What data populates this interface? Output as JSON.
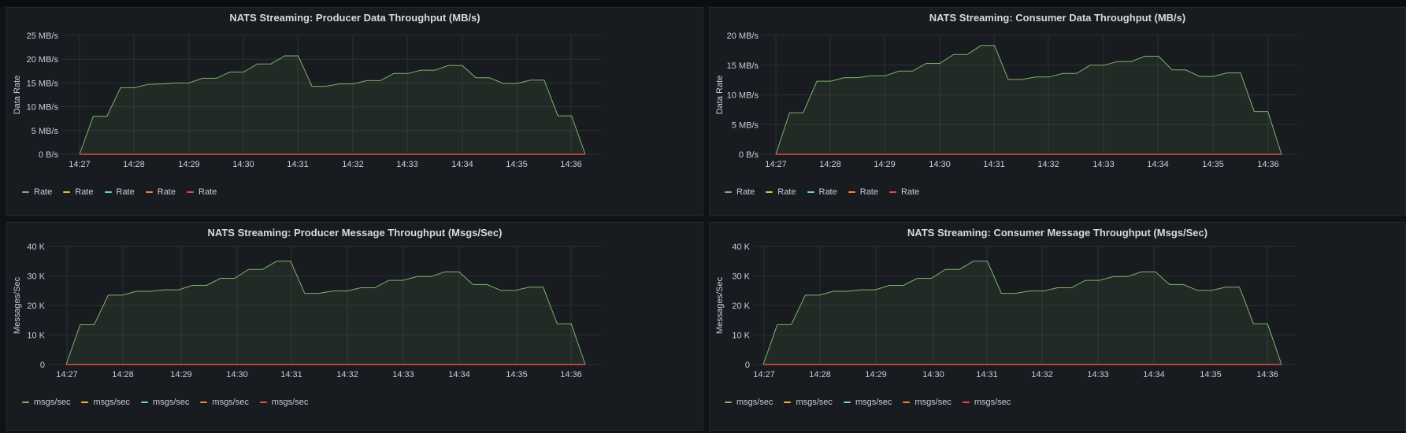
{
  "chart_data": [
    {
      "type": "area",
      "title": "NATS Streaming: Producer Data Throughput (MB/s)",
      "ylabel": "Data Rate",
      "xlabel": "",
      "x_ticks": [
        "14:27",
        "14:28",
        "14:29",
        "14:30",
        "14:31",
        "14:32",
        "14:33",
        "14:34",
        "14:35",
        "14:36"
      ],
      "y_ticks": [
        "0 B/s",
        "5 MB/s",
        "10 MB/s",
        "15 MB/s",
        "20 MB/s",
        "25 MB/s"
      ],
      "ylim": [
        0,
        25
      ],
      "x": [
        "14:27:00",
        "14:27:15",
        "14:27:30",
        "14:27:45",
        "14:28:00",
        "14:28:15",
        "14:28:30",
        "14:28:45",
        "14:29:00",
        "14:29:15",
        "14:29:30",
        "14:29:45",
        "14:30:00",
        "14:30:15",
        "14:30:30",
        "14:30:45",
        "14:31:00",
        "14:31:15",
        "14:31:30",
        "14:31:45",
        "14:32:00",
        "14:32:15",
        "14:32:30",
        "14:32:45",
        "14:33:00",
        "14:33:15",
        "14:33:30",
        "14:33:45",
        "14:34:00",
        "14:34:15",
        "14:34:30",
        "14:34:45",
        "14:35:00",
        "14:35:15",
        "14:35:30",
        "14:35:45",
        "14:36:00",
        "14:36:15"
      ],
      "grid": true,
      "legend_position": "bottom-left",
      "series": [
        {
          "name": "Rate",
          "color": "#7eb26d",
          "values": [
            0,
            8,
            8,
            14,
            14,
            14.7,
            14.8,
            15,
            15,
            16,
            16,
            17.3,
            17.3,
            19,
            19,
            20.7,
            20.7,
            14.3,
            14.3,
            14.8,
            14.8,
            15.5,
            15.5,
            17,
            17,
            17.7,
            17.7,
            18.7,
            18.7,
            16.1,
            16.1,
            14.9,
            14.9,
            15.6,
            15.6,
            8.1,
            8.1,
            0
          ]
        },
        {
          "name": "Rate",
          "color": "#eab839",
          "values": []
        },
        {
          "name": "Rate",
          "color": "#6ed0e0",
          "values": []
        },
        {
          "name": "Rate",
          "color": "#ef843c",
          "values": []
        },
        {
          "name": "Rate",
          "color": "#e24d42",
          "values": [
            0,
            0,
            0,
            0,
            0,
            0,
            0,
            0,
            0,
            0,
            0,
            0,
            0,
            0,
            0,
            0,
            0,
            0,
            0,
            0,
            0,
            0,
            0,
            0,
            0,
            0,
            0,
            0,
            0,
            0,
            0,
            0,
            0,
            0,
            0,
            0,
            0,
            0
          ]
        }
      ]
    },
    {
      "type": "area",
      "title": "NATS Streaming: Consumer Data Throughput (MB/s)",
      "ylabel": "Data Rate",
      "xlabel": "",
      "x_ticks": [
        "14:27",
        "14:28",
        "14:29",
        "14:30",
        "14:31",
        "14:32",
        "14:33",
        "14:34",
        "14:35",
        "14:36"
      ],
      "y_ticks": [
        "0 B/s",
        "5 MB/s",
        "10 MB/s",
        "15 MB/s",
        "20 MB/s"
      ],
      "ylim": [
        0,
        20
      ],
      "x": [
        "14:27:00",
        "14:27:15",
        "14:27:30",
        "14:27:45",
        "14:28:00",
        "14:28:15",
        "14:28:30",
        "14:28:45",
        "14:29:00",
        "14:29:15",
        "14:29:30",
        "14:29:45",
        "14:30:00",
        "14:30:15",
        "14:30:30",
        "14:30:45",
        "14:31:00",
        "14:31:15",
        "14:31:30",
        "14:31:45",
        "14:32:00",
        "14:32:15",
        "14:32:30",
        "14:32:45",
        "14:33:00",
        "14:33:15",
        "14:33:30",
        "14:33:45",
        "14:34:00",
        "14:34:15",
        "14:34:30",
        "14:34:45",
        "14:35:00",
        "14:35:15",
        "14:35:30",
        "14:35:45",
        "14:36:00",
        "14:36:15"
      ],
      "grid": true,
      "legend_position": "bottom-left",
      "series": [
        {
          "name": "Rate",
          "color": "#7eb26d",
          "values": [
            0,
            7,
            7,
            12.3,
            12.3,
            12.9,
            12.9,
            13.2,
            13.2,
            14,
            14,
            15.3,
            15.3,
            16.8,
            16.8,
            18.3,
            18.3,
            12.6,
            12.6,
            13,
            13,
            13.6,
            13.6,
            15,
            15,
            15.6,
            15.6,
            16.5,
            16.5,
            14.2,
            14.2,
            13.1,
            13.1,
            13.7,
            13.7,
            7.2,
            7.2,
            0
          ]
        },
        {
          "name": "Rate",
          "color": "#eab839",
          "values": []
        },
        {
          "name": "Rate",
          "color": "#6ed0e0",
          "values": []
        },
        {
          "name": "Rate",
          "color": "#ef843c",
          "values": []
        },
        {
          "name": "Rate",
          "color": "#e24d42",
          "values": [
            0,
            0,
            0,
            0,
            0,
            0,
            0,
            0,
            0,
            0,
            0,
            0,
            0,
            0,
            0,
            0,
            0,
            0,
            0,
            0,
            0,
            0,
            0,
            0,
            0,
            0,
            0,
            0,
            0,
            0,
            0,
            0,
            0,
            0,
            0,
            0,
            0,
            0
          ]
        }
      ]
    },
    {
      "type": "area",
      "title": "NATS Streaming: Producer Message Throughput (Msgs/Sec)",
      "ylabel": "Messages/Sec",
      "xlabel": "",
      "x_ticks": [
        "14:27",
        "14:28",
        "14:29",
        "14:30",
        "14:31",
        "14:32",
        "14:33",
        "14:34",
        "14:35",
        "14:36"
      ],
      "y_ticks": [
        "0",
        "10 K",
        "20 K",
        "30 K",
        "40 K"
      ],
      "ylim": [
        0,
        40000
      ],
      "x": [
        "14:27:00",
        "14:27:15",
        "14:27:30",
        "14:27:45",
        "14:28:00",
        "14:28:15",
        "14:28:30",
        "14:28:45",
        "14:29:00",
        "14:29:15",
        "14:29:30",
        "14:29:45",
        "14:30:00",
        "14:30:15",
        "14:30:30",
        "14:30:45",
        "14:31:00",
        "14:31:15",
        "14:31:30",
        "14:31:45",
        "14:32:00",
        "14:32:15",
        "14:32:30",
        "14:32:45",
        "14:33:00",
        "14:33:15",
        "14:33:30",
        "14:33:45",
        "14:34:00",
        "14:34:15",
        "14:34:30",
        "14:34:45",
        "14:35:00",
        "14:35:15",
        "14:35:30",
        "14:35:45",
        "14:36:00",
        "14:36:15"
      ],
      "grid": true,
      "legend_position": "bottom-left",
      "series": [
        {
          "name": "msgs/sec",
          "color": "#7eb26d",
          "values": [
            0,
            13500,
            13500,
            23500,
            23500,
            24800,
            24800,
            25300,
            25300,
            26800,
            26800,
            29200,
            29200,
            32200,
            32200,
            35000,
            35000,
            24100,
            24100,
            24900,
            24900,
            26000,
            26000,
            28500,
            28500,
            29800,
            29800,
            31400,
            31400,
            27100,
            27100,
            25100,
            25100,
            26200,
            26200,
            13800,
            13800,
            0
          ]
        },
        {
          "name": "msgs/sec",
          "color": "#eab839",
          "values": []
        },
        {
          "name": "msgs/sec",
          "color": "#6ed0e0",
          "values": []
        },
        {
          "name": "msgs/sec",
          "color": "#ef843c",
          "values": []
        },
        {
          "name": "msgs/sec",
          "color": "#e24d42",
          "values": [
            0,
            0,
            0,
            0,
            0,
            0,
            0,
            0,
            0,
            0,
            0,
            0,
            0,
            0,
            0,
            0,
            0,
            0,
            0,
            0,
            0,
            0,
            0,
            0,
            0,
            0,
            0,
            0,
            0,
            0,
            0,
            0,
            0,
            0,
            0,
            0,
            0,
            0
          ]
        }
      ]
    },
    {
      "type": "area",
      "title": "NATS Streaming: Consumer Message Throughput (Msgs/Sec)",
      "ylabel": "Messages/Sec",
      "xlabel": "",
      "x_ticks": [
        "14:27",
        "14:28",
        "14:29",
        "14:30",
        "14:31",
        "14:32",
        "14:33",
        "14:34",
        "14:35",
        "14:36"
      ],
      "y_ticks": [
        "0",
        "10 K",
        "20 K",
        "30 K",
        "40 K"
      ],
      "ylim": [
        0,
        40000
      ],
      "x": [
        "14:27:00",
        "14:27:15",
        "14:27:30",
        "14:27:45",
        "14:28:00",
        "14:28:15",
        "14:28:30",
        "14:28:45",
        "14:29:00",
        "14:29:15",
        "14:29:30",
        "14:29:45",
        "14:30:00",
        "14:30:15",
        "14:30:30",
        "14:30:45",
        "14:31:00",
        "14:31:15",
        "14:31:30",
        "14:31:45",
        "14:32:00",
        "14:32:15",
        "14:32:30",
        "14:32:45",
        "14:33:00",
        "14:33:15",
        "14:33:30",
        "14:33:45",
        "14:34:00",
        "14:34:15",
        "14:34:30",
        "14:34:45",
        "14:35:00",
        "14:35:15",
        "14:35:30",
        "14:35:45",
        "14:36:00",
        "14:36:15"
      ],
      "grid": true,
      "legend_position": "bottom-left",
      "series": [
        {
          "name": "msgs/sec",
          "color": "#7eb26d",
          "values": [
            0,
            13500,
            13500,
            23500,
            23500,
            24800,
            24800,
            25300,
            25300,
            26800,
            26800,
            29200,
            29200,
            32200,
            32200,
            35000,
            35000,
            24100,
            24100,
            24900,
            24900,
            26000,
            26000,
            28500,
            28500,
            29800,
            29800,
            31400,
            31400,
            27100,
            27100,
            25100,
            25100,
            26200,
            26200,
            13800,
            13800,
            0
          ]
        },
        {
          "name": "msgs/sec",
          "color": "#eab839",
          "values": []
        },
        {
          "name": "msgs/sec",
          "color": "#6ed0e0",
          "values": []
        },
        {
          "name": "msgs/sec",
          "color": "#ef843c",
          "values": []
        },
        {
          "name": "msgs/sec",
          "color": "#e24d42",
          "values": [
            0,
            0,
            0,
            0,
            0,
            0,
            0,
            0,
            0,
            0,
            0,
            0,
            0,
            0,
            0,
            0,
            0,
            0,
            0,
            0,
            0,
            0,
            0,
            0,
            0,
            0,
            0,
            0,
            0,
            0,
            0,
            0,
            0,
            0,
            0,
            0,
            0,
            0
          ]
        }
      ]
    }
  ]
}
